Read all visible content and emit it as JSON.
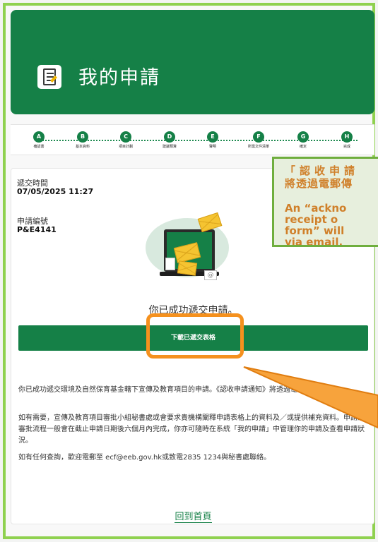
{
  "header": {
    "title": "我的申請",
    "icon": "form-edit-icon"
  },
  "steps": [
    {
      "letter": "A",
      "label": "確認書"
    },
    {
      "letter": "B",
      "label": "基本資料"
    },
    {
      "letter": "C",
      "label": "項目計劃"
    },
    {
      "letter": "D",
      "label": "建議預算"
    },
    {
      "letter": "E",
      "label": "聲明"
    },
    {
      "letter": "F",
      "label": "所需文件清單"
    },
    {
      "letter": "G",
      "label": "確定"
    },
    {
      "letter": "H",
      "label": "完成"
    }
  ],
  "submission": {
    "time_label": "遞交時間",
    "time_value": "07/05/2025 11:27",
    "number_label": "申請編號",
    "number_value": "P&E4141",
    "success_message": "你已成功遞交申請。",
    "download_button": "下載已遞交表格"
  },
  "paragraphs": {
    "p1": "你已成功遞交環境及自然保育基金轄下宣傳及教育項目的申請。《認收申請通知》將透過電郵傳送給你。",
    "p2": "如有需要，宣傳及教育項目審批小組秘書處或會要求貴機構闡釋申請表格上的資料及／或提供補充資料。申請及審批流程一般會在截止申請日期後六個月內完成，你亦可隨時在系統「我的申請」中管理你的申請及查看申請狀況。",
    "p3": "如有任何查詢，歡迎電郵至 ecf@eeb.gov.hk或致電2835 1234與秘書處聯絡。"
  },
  "home_link": "回到首頁",
  "annotation": {
    "zh_line1": "「認收申請",
    "zh_line2": "將透過電郵傳",
    "en_line1": "An  “ackno",
    "en_line2": "receipt    o",
    "en_line3": "form”  will",
    "en_line4": "via email."
  },
  "colors": {
    "brand_green": "#158047",
    "highlight_orange": "#f5911e",
    "callout_border": "#6fae3e"
  }
}
